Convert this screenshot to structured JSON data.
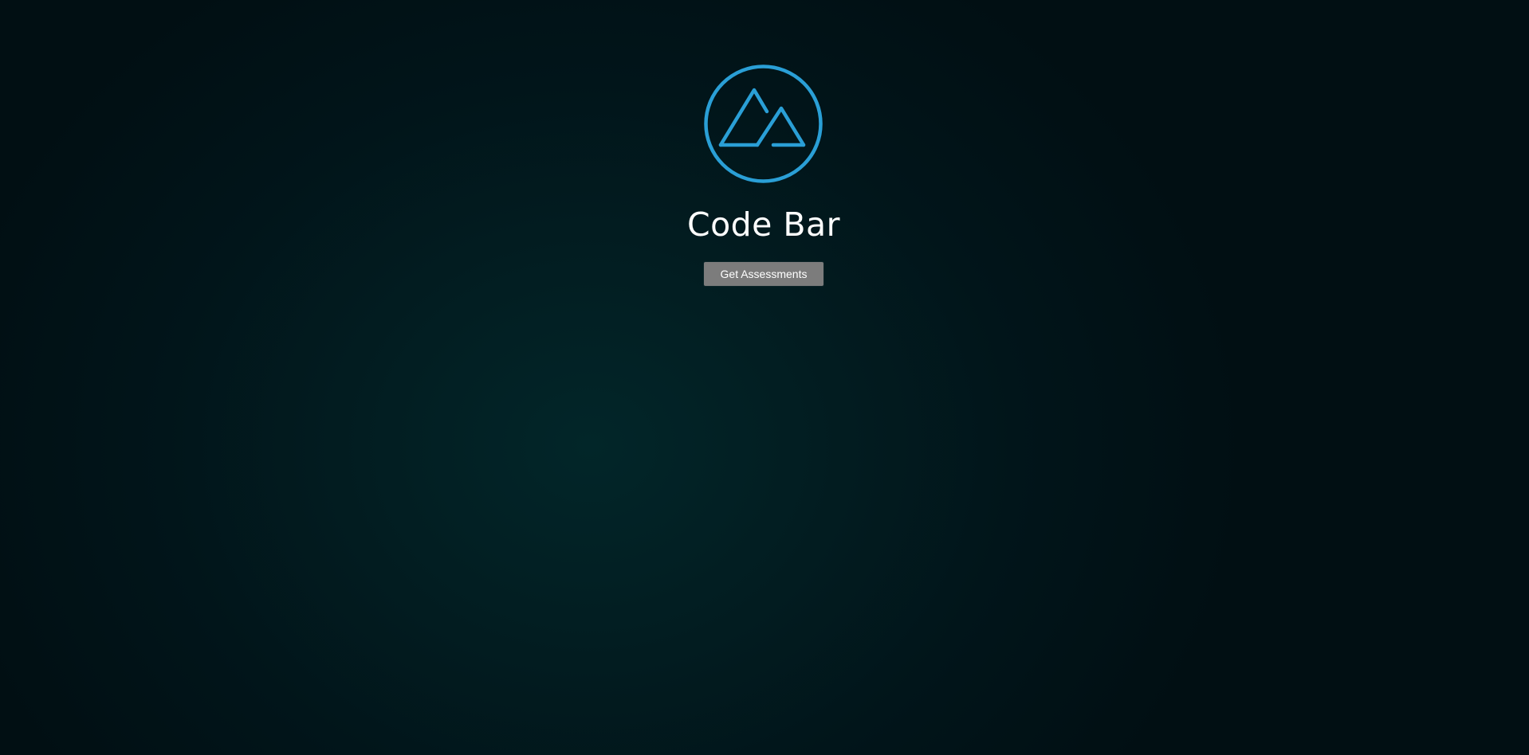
{
  "app": {
    "title": "Code Bar"
  },
  "logo": {
    "icon": "mountain-icon",
    "color": "#2a9fd6"
  },
  "actions": {
    "get_assessments_label": "Get Assessments"
  },
  "colors": {
    "background_center": "#022629",
    "background_edge": "#010f13",
    "button_bg": "#7c7c7c",
    "title_text": "#ffffff"
  }
}
